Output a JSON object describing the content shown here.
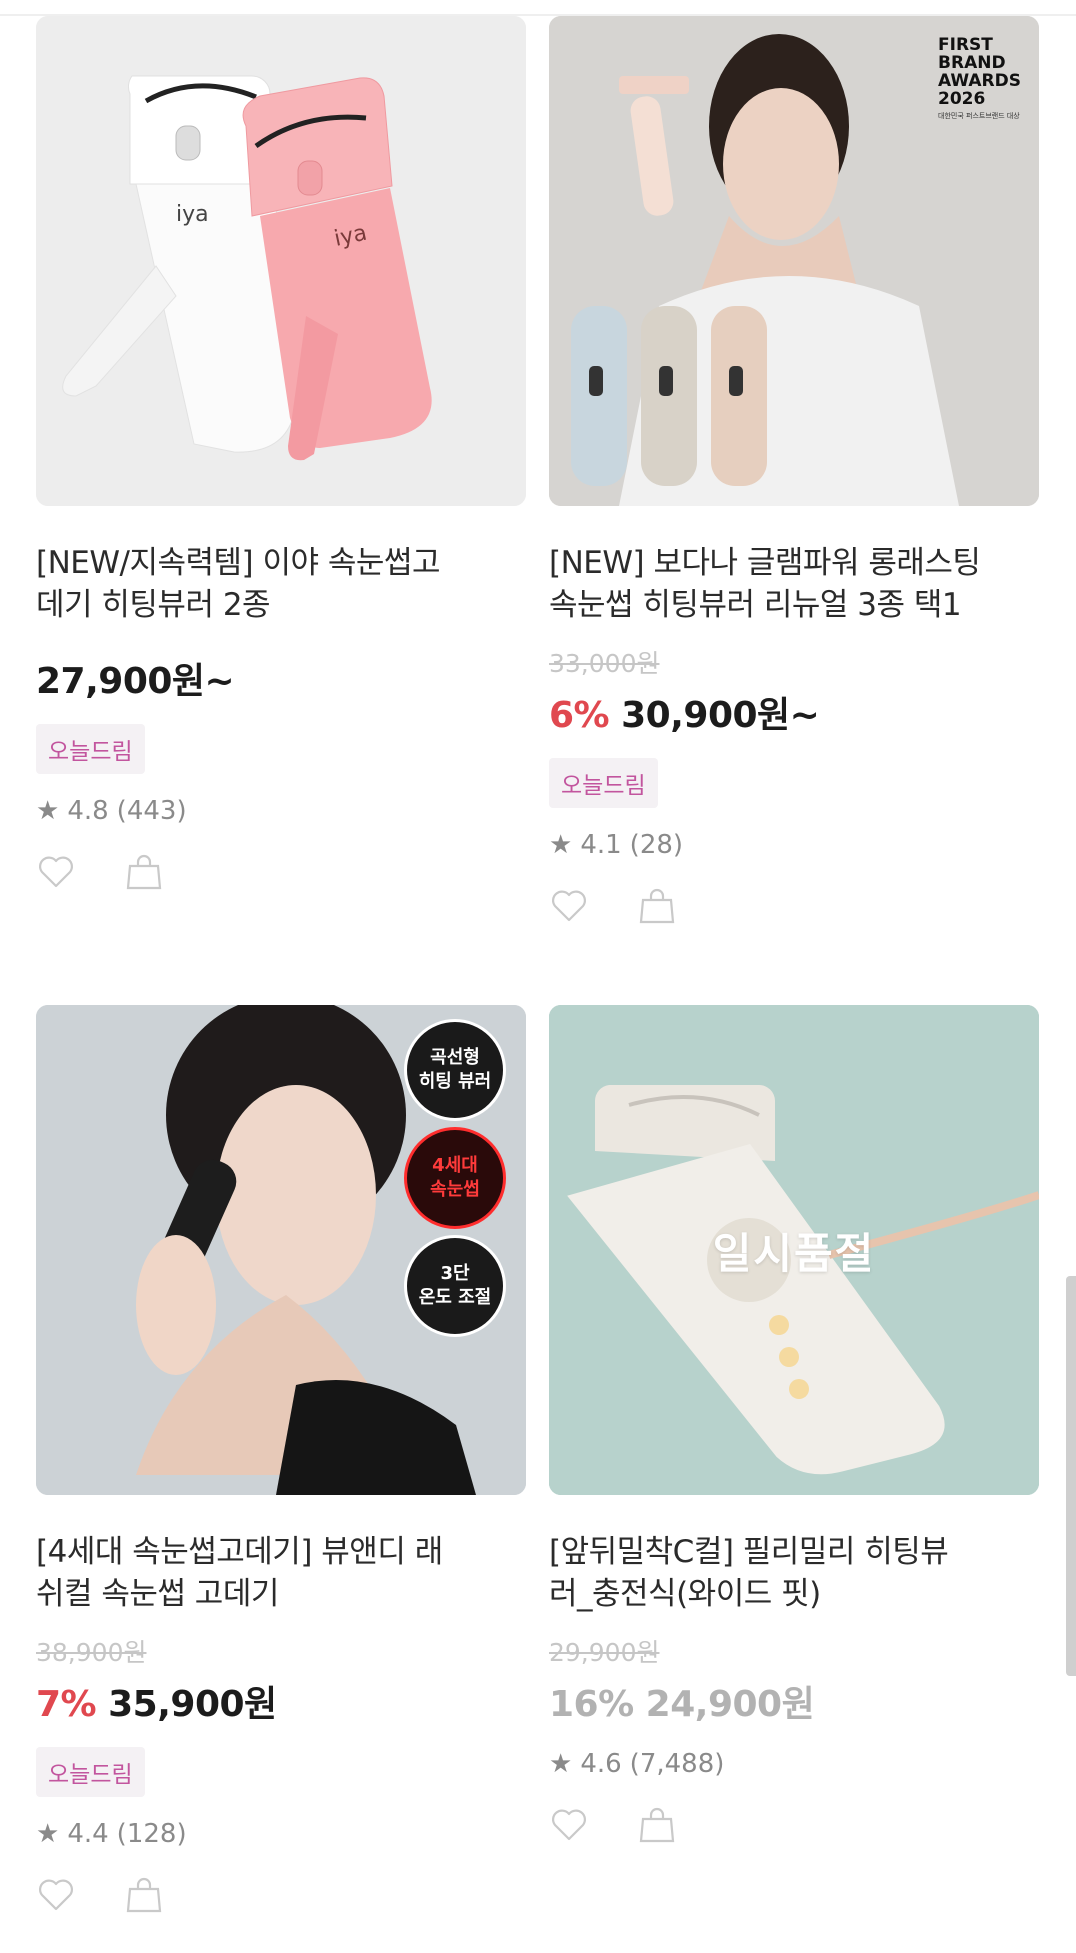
{
  "products": [
    {
      "title": "[NEW/지속력템] 이야 속눈썹고\n데기 히팅뷰러 2종",
      "original_price": "",
      "discount": "",
      "price": "27,900원~",
      "badge": "오늘드림",
      "rating": "4.8",
      "reviews": "(443)",
      "image_logo": "iya"
    },
    {
      "title": "[NEW] 보다나 글램파워 롱래스팅\n속눈썹 히팅뷰러 리뉴얼 3종 택1",
      "original_price": "33,000원",
      "discount": "6%",
      "price": "30,900원~",
      "badge": "오늘드림",
      "rating": "4.1",
      "reviews": "(28)",
      "award_lines": [
        "FIRST",
        "BRAND",
        "AWARDS",
        "2026"
      ],
      "award_sub": "대한민국 퍼스트브랜드 대상"
    },
    {
      "title": "[4세대 속눈썹고데기] 뷰앤디 래\n쉬컬 속눈썹 고데기",
      "original_price": "38,900원",
      "discount": "7%",
      "price": "35,900원",
      "badge": "오늘드림",
      "rating": "4.4",
      "reviews": "(128)",
      "circle_badges": [
        "곡선형\n히팅 뷰러",
        "4세대\n속눈썹",
        "3단\n온도 조절"
      ]
    },
    {
      "title": "[앞뒤밀착C컬] 필리밀리 히팅뷰\n러_충전식(와이드 핏)",
      "original_price": "29,900원",
      "discount": "16%",
      "price": "24,900원",
      "badge": "",
      "rating": "4.6",
      "reviews": "(7,488)",
      "status": "일시품절"
    }
  ],
  "colors": {
    "discount": "#e0484f",
    "badge_text": "#c2559e",
    "badge_bg": "#f4f1f4",
    "soldout_price": "#b2b2b2"
  },
  "icons": {
    "rating": "star-icon",
    "wish": "heart-icon",
    "cart": "shopping-bag-icon"
  }
}
